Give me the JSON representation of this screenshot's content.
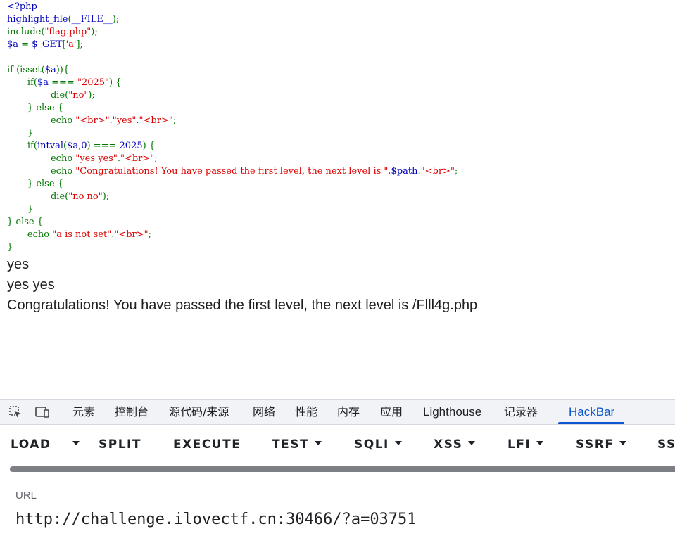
{
  "code": {
    "lines": [
      [
        {
          "t": "<?php",
          "c": "def"
        }
      ],
      [
        {
          "t": "highlight_file",
          "c": "def"
        },
        {
          "t": "(",
          "c": "kw"
        },
        {
          "t": "__FILE__",
          "c": "def"
        },
        {
          "t": ");",
          "c": "kw"
        }
      ],
      [
        {
          "t": "include",
          "c": "kw"
        },
        {
          "t": "(",
          "c": "kw"
        },
        {
          "t": "\"flag.php\"",
          "c": "str"
        },
        {
          "t": ");",
          "c": "kw"
        }
      ],
      [
        {
          "t": "$a ",
          "c": "def"
        },
        {
          "t": "= ",
          "c": "kw"
        },
        {
          "t": "$_GET",
          "c": "def"
        },
        {
          "t": "[",
          "c": "kw"
        },
        {
          "t": "'a'",
          "c": "str"
        },
        {
          "t": "];",
          "c": "kw"
        }
      ],
      [
        {
          "t": "",
          "c": "def"
        }
      ],
      [
        {
          "t": "if ",
          "c": "kw"
        },
        {
          "t": "(isset(",
          "c": "kw"
        },
        {
          "t": "$a",
          "c": "def"
        },
        {
          "t": ")){",
          "c": "kw"
        }
      ],
      [
        {
          "t": "       if(",
          "c": "kw"
        },
        {
          "t": "$a ",
          "c": "def"
        },
        {
          "t": "=== ",
          "c": "kw"
        },
        {
          "t": "\"2025\"",
          "c": "str"
        },
        {
          "t": ") {",
          "c": "kw"
        }
      ],
      [
        {
          "t": "               die(",
          "c": "kw"
        },
        {
          "t": "\"no\"",
          "c": "str"
        },
        {
          "t": ");",
          "c": "kw"
        }
      ],
      [
        {
          "t": "       } else {",
          "c": "kw"
        }
      ],
      [
        {
          "t": "               echo ",
          "c": "kw"
        },
        {
          "t": "\"<br>\"",
          "c": "str"
        },
        {
          "t": ".",
          "c": "kw"
        },
        {
          "t": "\"yes\"",
          "c": "str"
        },
        {
          "t": ".",
          "c": "kw"
        },
        {
          "t": "\"<br>\"",
          "c": "str"
        },
        {
          "t": ";",
          "c": "kw"
        }
      ],
      [
        {
          "t": "       }",
          "c": "kw"
        }
      ],
      [
        {
          "t": "       if(",
          "c": "kw"
        },
        {
          "t": "intval",
          "c": "def"
        },
        {
          "t": "(",
          "c": "kw"
        },
        {
          "t": "$a",
          "c": "def"
        },
        {
          "t": ",",
          "c": "kw"
        },
        {
          "t": "0",
          "c": "def"
        },
        {
          "t": ") === ",
          "c": "kw"
        },
        {
          "t": "2025",
          "c": "def"
        },
        {
          "t": ") {",
          "c": "kw"
        }
      ],
      [
        {
          "t": "               echo ",
          "c": "kw"
        },
        {
          "t": "\"yes yes\"",
          "c": "str"
        },
        {
          "t": ".",
          "c": "kw"
        },
        {
          "t": "\"<br>\"",
          "c": "str"
        },
        {
          "t": ";",
          "c": "kw"
        }
      ],
      [
        {
          "t": "               echo ",
          "c": "kw"
        },
        {
          "t": "\"Congratulations! You have passed the first level, the next level is \"",
          "c": "str"
        },
        {
          "t": ".",
          "c": "kw"
        },
        {
          "t": "$path",
          "c": "def"
        },
        {
          "t": ".",
          "c": "kw"
        },
        {
          "t": "\"<br>\"",
          "c": "str"
        },
        {
          "t": ";",
          "c": "kw"
        }
      ],
      [
        {
          "t": "       } else {",
          "c": "kw"
        }
      ],
      [
        {
          "t": "               die(",
          "c": "kw"
        },
        {
          "t": "\"no no\"",
          "c": "str"
        },
        {
          "t": ");",
          "c": "kw"
        }
      ],
      [
        {
          "t": "       }",
          "c": "kw"
        }
      ],
      [
        {
          "t": "} else {",
          "c": "kw"
        }
      ],
      [
        {
          "t": "       echo ",
          "c": "kw"
        },
        {
          "t": "\"a is not set\"",
          "c": "str"
        },
        {
          "t": ".",
          "c": "kw"
        },
        {
          "t": "\"<br>\"",
          "c": "str"
        },
        {
          "t": ";",
          "c": "kw"
        }
      ],
      [
        {
          "t": "}",
          "c": "kw"
        }
      ]
    ]
  },
  "output": {
    "line1": "yes",
    "line2": "yes yes",
    "line3": "Congratulations! You have passed the first level, the next level is /Flll4g.php"
  },
  "devtools": {
    "tabs": [
      "元素",
      "控制台",
      "源代码/来源",
      "网络",
      "性能",
      "内存",
      "应用",
      "Lighthouse",
      "记录器",
      "HackBar"
    ],
    "active_tab": "HackBar",
    "icons": {
      "inspect": "inspect-element-icon",
      "device": "device-toolbar-icon"
    }
  },
  "hackbar": {
    "load": "LOAD",
    "split": "SPLIT",
    "execute": "EXECUTE",
    "test": "TEST",
    "sqli": "SQLI",
    "xss": "XSS",
    "lfi": "LFI",
    "ssrf": "SSRF",
    "ssti": "SS",
    "url_label": "URL",
    "url_value": "http://challenge.ilovectf.cn:30466/?a=03751"
  },
  "colors": {
    "php_default": "#0000BB",
    "php_keyword": "#007700",
    "php_string": "#DD0000",
    "active_tab": "#0b57d0"
  }
}
